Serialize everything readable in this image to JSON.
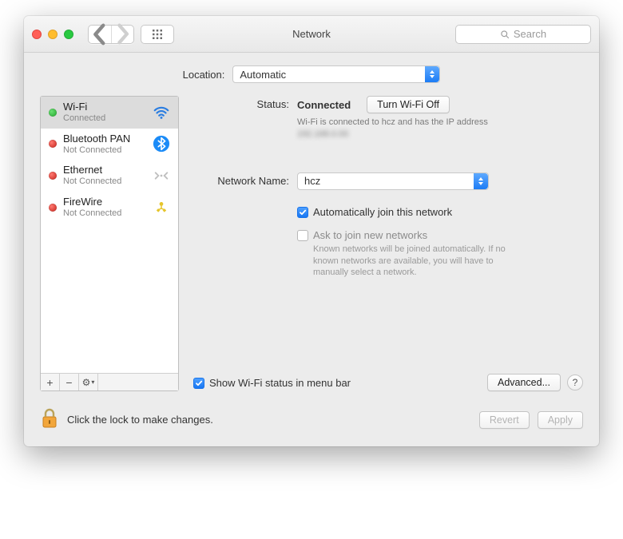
{
  "titlebar": {
    "title": "Network",
    "search_placeholder": "Search"
  },
  "location": {
    "label": "Location:",
    "value": "Automatic"
  },
  "sidebar": {
    "items": [
      {
        "name": "Wi-Fi",
        "status": "Connected",
        "dot": "green",
        "selected": true,
        "icon": "wifi"
      },
      {
        "name": "Bluetooth PAN",
        "status": "Not Connected",
        "dot": "red",
        "selected": false,
        "icon": "bluetooth"
      },
      {
        "name": "Ethernet",
        "status": "Not Connected",
        "dot": "red",
        "selected": false,
        "icon": "ethernet"
      },
      {
        "name": "FireWire",
        "status": "Not Connected",
        "dot": "red",
        "selected": false,
        "icon": "firewire"
      }
    ],
    "footer": {
      "add": "+",
      "remove": "−",
      "gear": "⚙︎"
    }
  },
  "detail": {
    "status_label": "Status:",
    "status_value": "Connected",
    "turn_off_label": "Turn Wi-Fi Off",
    "status_desc_prefix": "Wi-Fi is connected to hcz and has the IP address ",
    "status_desc_ip": "192.168.0.00",
    "network_name_label": "Network Name:",
    "network_name_value": "hcz",
    "auto_join_label": "Automatically join this network",
    "ask_join_label": "Ask to join new networks",
    "ask_join_hint": "Known networks will be joined automatically. If no known networks are available, you will have to manually select a network.",
    "show_menu_bar_label": "Show Wi-Fi status in menu bar",
    "advanced_label": "Advanced...",
    "help_label": "?"
  },
  "footer": {
    "lock_text": "Click the lock to make changes.",
    "revert_label": "Revert",
    "apply_label": "Apply"
  }
}
